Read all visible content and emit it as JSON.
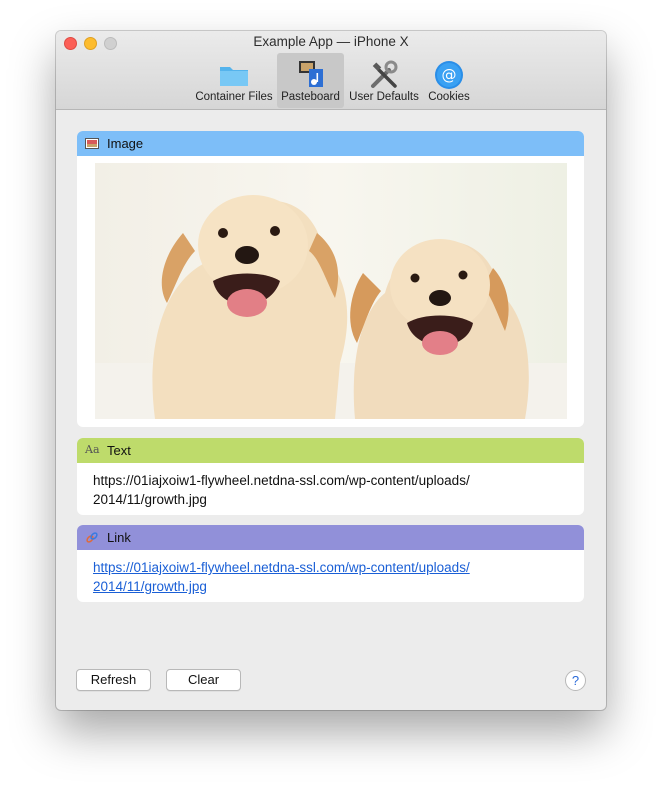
{
  "window": {
    "title": "Example App — iPhone X"
  },
  "toolbar": {
    "items": [
      {
        "label": "Container Files",
        "icon": "folder-icon",
        "selected": false
      },
      {
        "label": "Pasteboard",
        "icon": "pasteboard-icon",
        "selected": true
      },
      {
        "label": "User Defaults",
        "icon": "tools-icon",
        "selected": false
      },
      {
        "label": "Cookies",
        "icon": "at-sign-icon",
        "selected": false
      }
    ]
  },
  "sections": {
    "image": {
      "header": "Image",
      "color": "#7dbef8",
      "image_description_icon": "image-icon"
    },
    "text": {
      "header": "Text",
      "color": "#bedb6b",
      "line1": "https://01iajxoiw1-flywheel.netdna-ssl.com/wp-content/uploads/",
      "line2": "2014/11/growth.jpg"
    },
    "link": {
      "header": "Link",
      "color": "#9190d9",
      "line1": "https://01iajxoiw1-flywheel.netdna-ssl.com/wp-content/uploads/",
      "line2": "2014/11/growth.jpg"
    }
  },
  "footer": {
    "refresh_label": "Refresh",
    "clear_label": "Clear",
    "help_label": "?"
  }
}
